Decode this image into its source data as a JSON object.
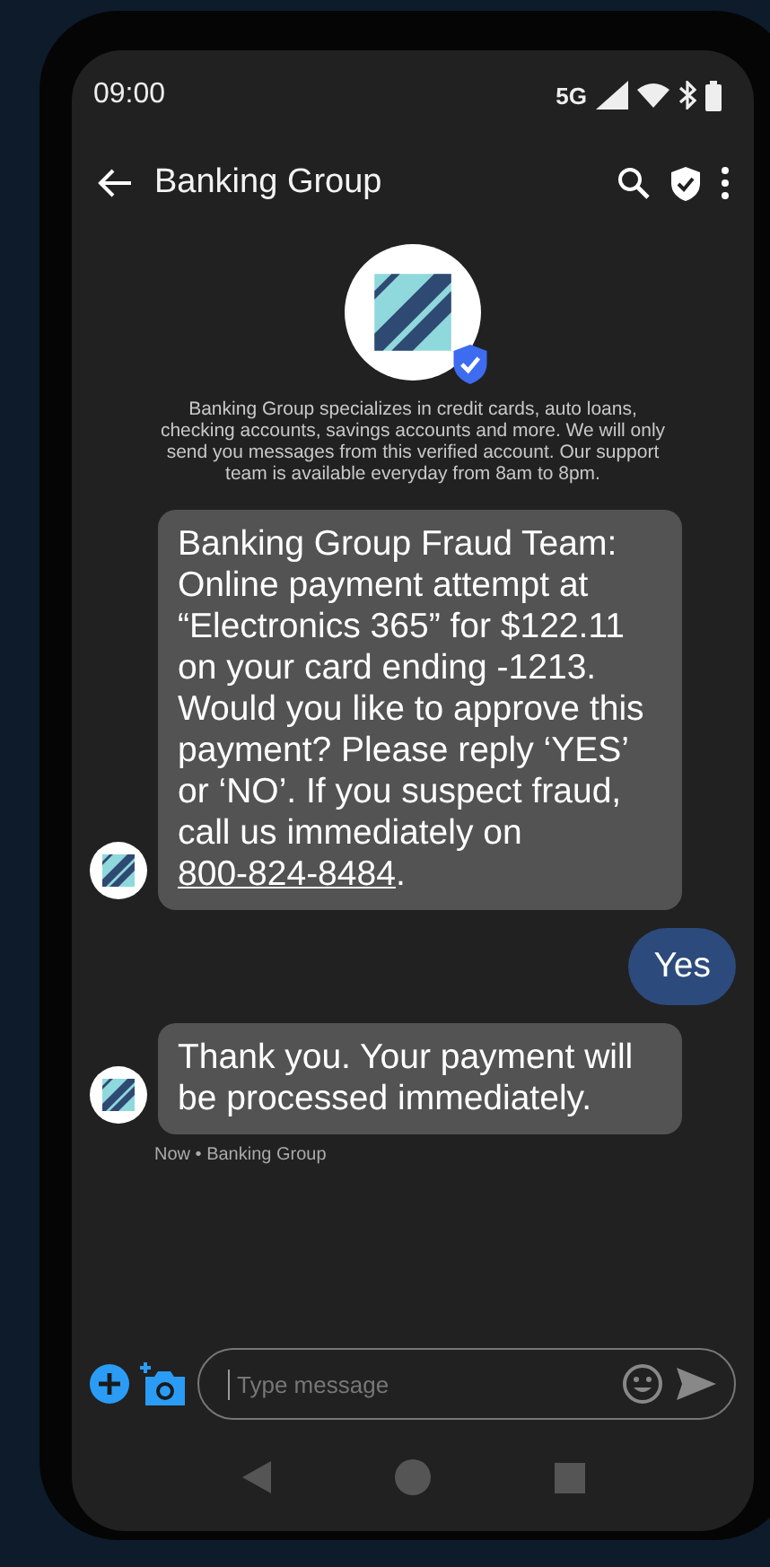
{
  "status_bar": {
    "time": "09:00",
    "network": "5G"
  },
  "header": {
    "title": "Banking Group"
  },
  "profile": {
    "description": "Banking Group specializes in credit cards, auto loans, checking accounts, savings accounts and more. We will only send you messages from this verified account. Our support team is available everyday from 8am to 8pm.",
    "verified": true
  },
  "messages": [
    {
      "kind": "incoming",
      "text": "Banking Group Fraud Team: Online payment attempt at “Electronics 365” for $122.11 on your card ending -1213. Would you like to approve this payment? Please reply ‘YES’ or ‘NO’. If you suspect fraud, call us immediately on ",
      "link": "800-824-8484",
      "after": "."
    },
    {
      "kind": "outgoing",
      "text": "Yes"
    },
    {
      "kind": "incoming",
      "text": "Thank you. Your payment will be processed immediately.",
      "meta": "Now • Banking Group"
    }
  ],
  "composer": {
    "placeholder": "Type message"
  }
}
